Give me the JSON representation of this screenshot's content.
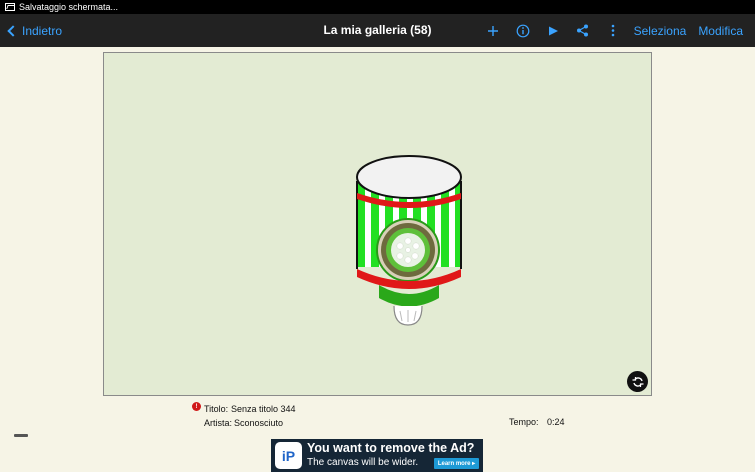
{
  "status_bar": {
    "notification": "Salvataggio schermata..."
  },
  "action_bar": {
    "back_label": "Indietro",
    "title": "La mia galleria (58)",
    "add_icon": "plus-icon",
    "info_icon": "info-icon",
    "play_icon": "play-icon",
    "share_icon": "share-icon",
    "menu_icon": "more-vert-icon",
    "select_label": "Seleziona",
    "edit_label": "Modifica",
    "accent_color": "#3aa3ff"
  },
  "canvas": {
    "background": "#e3ebd3",
    "rotate_icon": "rotate-icon"
  },
  "artwork_info": {
    "title_label": "Titolo:",
    "title_value": "Senza titolo 344",
    "artist_label": "Artista:",
    "artist_value": "Sconosciuto",
    "time_label": "Tempo:",
    "time_value": "0:24"
  },
  "ad": {
    "logo_text": "iP",
    "headline": "You want to remove the Ad?",
    "subline": "The canvas will be wider.",
    "cta": "Learn more ▸"
  }
}
